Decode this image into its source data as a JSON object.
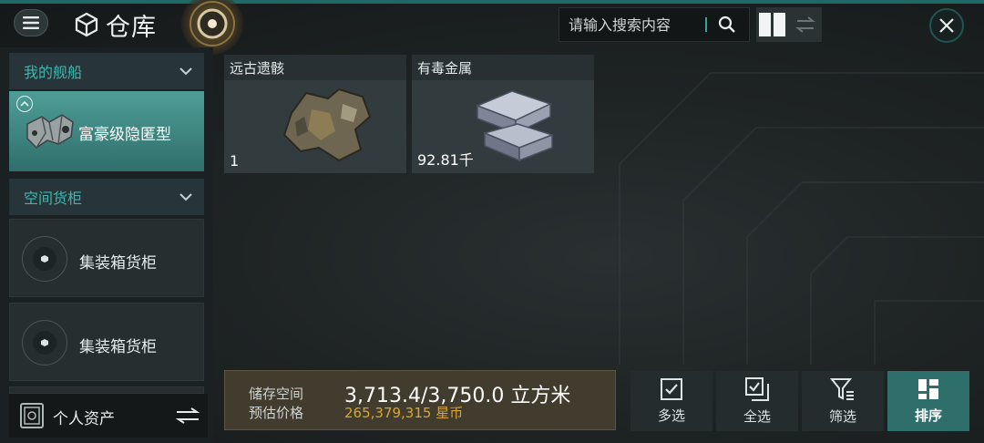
{
  "header": {
    "title": "仓库",
    "search_placeholder": "请输入搜索内容"
  },
  "sidebar": {
    "sections": [
      {
        "label": "我的舰船"
      },
      {
        "label": "空间货柜"
      }
    ],
    "ship": {
      "name": "富豪级隐匿型"
    },
    "containers": [
      {
        "name": "集装箱货柜"
      },
      {
        "name": "集装箱货柜"
      }
    ],
    "assets_label": "个人资产"
  },
  "items": [
    {
      "name": "远古遗骸",
      "qty": "1"
    },
    {
      "name": "有毒金属",
      "qty": "92.81千"
    }
  ],
  "storage": {
    "space_label": "储存空间",
    "space_value": "3,713.4/3,750.0 立方米",
    "price_label": "预估价格",
    "price_value": "265,379,315 星币"
  },
  "actions": [
    {
      "label": "多选",
      "icon": "multi-select-icon"
    },
    {
      "label": "全选",
      "icon": "select-all-icon"
    },
    {
      "label": "筛选",
      "icon": "filter-icon"
    },
    {
      "label": "排序",
      "icon": "sort-icon"
    }
  ],
  "colors": {
    "accent": "#3fb6ad",
    "active": "#2f6f6b",
    "price": "#d9a531"
  }
}
